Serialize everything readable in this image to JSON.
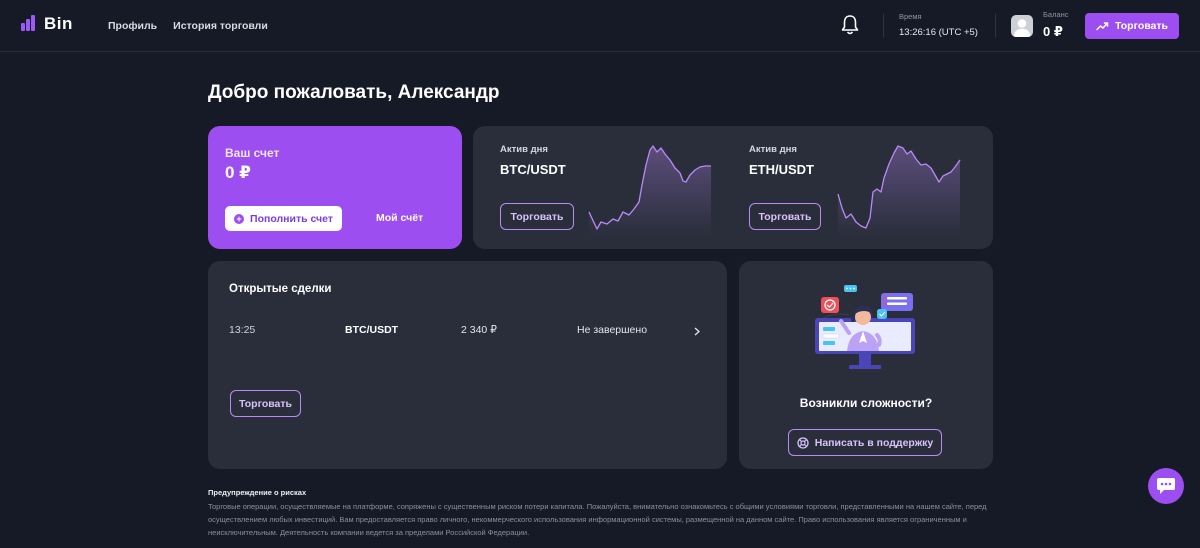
{
  "header": {
    "logo_text": "Bin",
    "nav": [
      {
        "label": "Профиль"
      },
      {
        "label": "История торговли"
      }
    ],
    "time_label": "Время",
    "time_value": "13:26:16 (UTC +5)",
    "balance_label": "Баланс",
    "balance_value": "0 ₽",
    "trade_button": "Торговать"
  },
  "main": {
    "welcome": "Добро пожаловать, Александр",
    "account": {
      "label": "Ваш счет",
      "balance": "0 ₽",
      "topup_button": "Пополнить счет",
      "my_account_link": "Мой счёт"
    },
    "assets": [
      {
        "label": "Актив дня",
        "pair": "BTC/USDT",
        "button": "Торговать"
      },
      {
        "label": "Актив дня",
        "pair": "ETH/USDT",
        "button": "Торговать"
      }
    ],
    "trades": {
      "title": "Открытые сделки",
      "rows": [
        {
          "time": "13:25",
          "pair": "BTC/USDT",
          "amount": "2 340 ₽",
          "status": "Не завершено"
        }
      ],
      "trade_button": "Торговать"
    },
    "support": {
      "question": "Возникли сложности?",
      "button": "Написать в поддержку"
    },
    "risk": {
      "title": "Предупреждение о рисках",
      "text": "Торговые операции, осуществляемые на платформе, сопряжены с существенным риском потери капитала. Пожалуйста, внимательно ознакомьтесь с общими условиями торговли, представленными на нашем сайте, перед осуществлением любых инвестиций. Вам предоставляется право личного, некоммерческого использования информационной системы, размещенной на данном сайте. Право использования является ограниченным и неисключительным. Деятельность компании ведется за пределами Российской Федерации."
    }
  },
  "colors": {
    "accent": "#9d4ef0",
    "background": "#151a26",
    "card": "#2a2e3b"
  }
}
